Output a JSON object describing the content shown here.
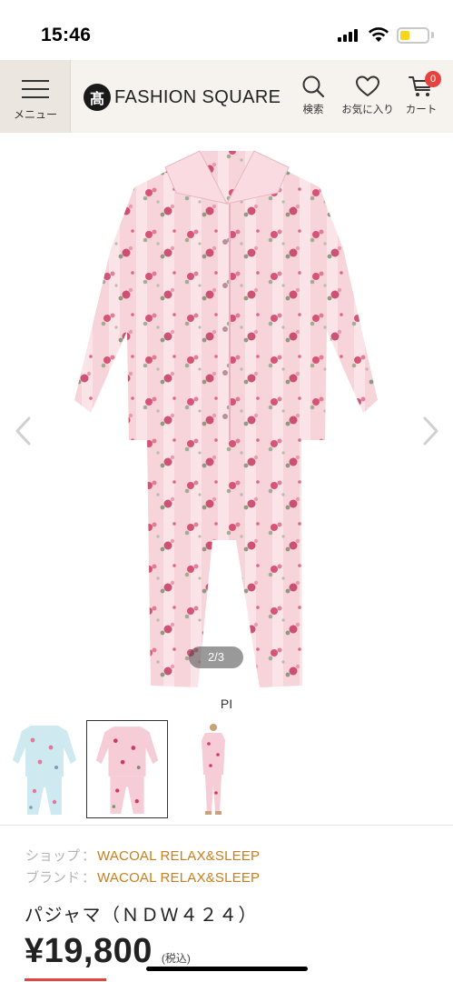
{
  "status_bar": {
    "time": "15:46"
  },
  "header": {
    "menu_label": "メニュー",
    "logo_mark": "髙",
    "logo_text": "FASHION SQUARE",
    "search_label": "検索",
    "favorites_label": "お気に入り",
    "cart_label": "カート",
    "cart_count": "0"
  },
  "gallery": {
    "page_indicator": "2/3",
    "color_code": "PI"
  },
  "thumbnails": [
    {
      "name": "blue-floral-pajama",
      "selected": false
    },
    {
      "name": "pink-floral-pajama",
      "selected": true
    },
    {
      "name": "pink-pajama-model",
      "selected": false
    }
  ],
  "product": {
    "shop_label": "ショップ",
    "shop_value": "WACOAL RELAX&SLEEP",
    "brand_label": "ブランド",
    "brand_value": "WACOAL RELAX&SLEEP",
    "separator": "：",
    "name": "パジャマ（ＮＤＷ４２４）",
    "price": "¥19,800",
    "tax_label": "(税込)"
  },
  "colors": {
    "accent": "#c77e1d",
    "badge": "#e6433f",
    "header_bg": "#f6f3ee",
    "pajama_pink": "#f6cdd6",
    "pajama_blue": "#cfe9f0"
  }
}
